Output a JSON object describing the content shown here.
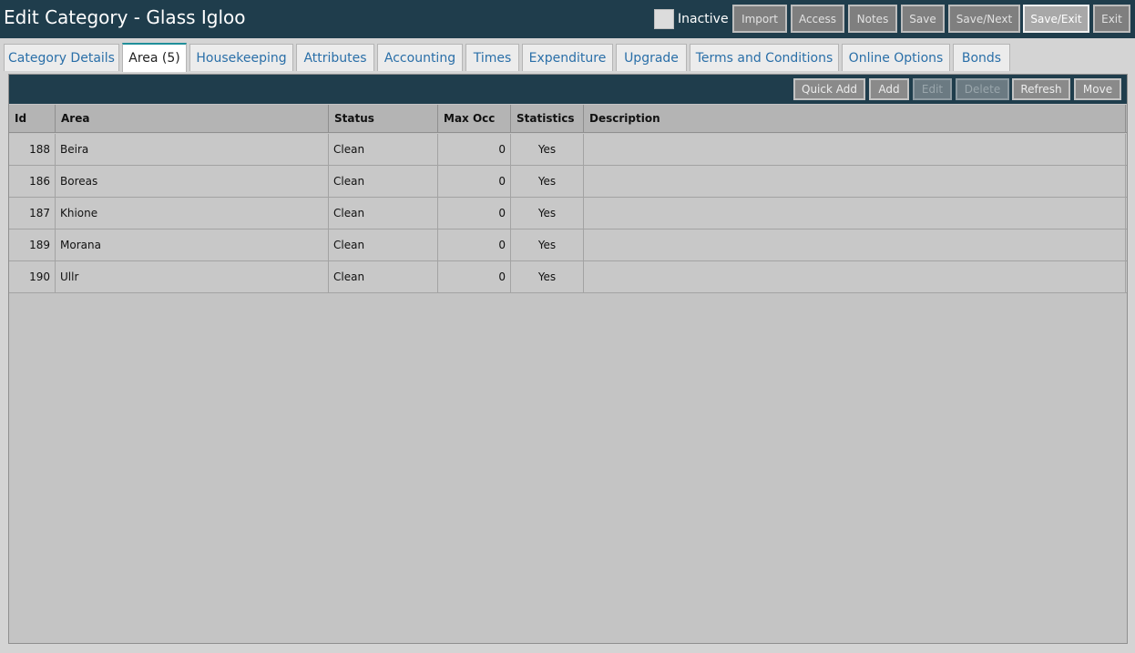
{
  "header": {
    "title": "Edit Category - Glass Igloo",
    "inactive_label": "Inactive",
    "buttons": {
      "import": "Import",
      "access": "Access",
      "notes": "Notes",
      "save": "Save",
      "save_next": "Save/Next",
      "save_exit": "Save/Exit",
      "exit": "Exit"
    }
  },
  "tabs": [
    {
      "label": "Category Details"
    },
    {
      "label": "Area (5)"
    },
    {
      "label": "Housekeeping"
    },
    {
      "label": "Attributes"
    },
    {
      "label": "Accounting"
    },
    {
      "label": "Times"
    },
    {
      "label": "Expenditure"
    },
    {
      "label": "Upgrade"
    },
    {
      "label": "Terms and Conditions"
    },
    {
      "label": "Online Options"
    },
    {
      "label": "Bonds"
    }
  ],
  "active_tab": "Area (5)",
  "toolbar": {
    "quick_add": "Quick Add",
    "add": "Add",
    "edit": "Edit",
    "delete": "Delete",
    "refresh": "Refresh",
    "move": "Move"
  },
  "table": {
    "columns": [
      "Id",
      "Area",
      "Status",
      "Max Occ",
      "Statistics",
      "Description"
    ],
    "rows": [
      {
        "id": "188",
        "area": "Beira",
        "status": "Clean",
        "max_occ": "0",
        "statistics": "Yes",
        "description": ""
      },
      {
        "id": "186",
        "area": "Boreas",
        "status": "Clean",
        "max_occ": "0",
        "statistics": "Yes",
        "description": ""
      },
      {
        "id": "187",
        "area": "Khione",
        "status": "Clean",
        "max_occ": "0",
        "statistics": "Yes",
        "description": ""
      },
      {
        "id": "189",
        "area": "Morana",
        "status": "Clean",
        "max_occ": "0",
        "statistics": "Yes",
        "description": ""
      },
      {
        "id": "190",
        "area": "Ullr",
        "status": "Clean",
        "max_occ": "0",
        "statistics": "Yes",
        "description": ""
      }
    ]
  },
  "colors": {
    "header_bg": "#1f3d4c",
    "tab_text": "#2a6fa8",
    "active_tab_accent": "#1f8f9a",
    "panel_bg": "#c4c4c4"
  }
}
